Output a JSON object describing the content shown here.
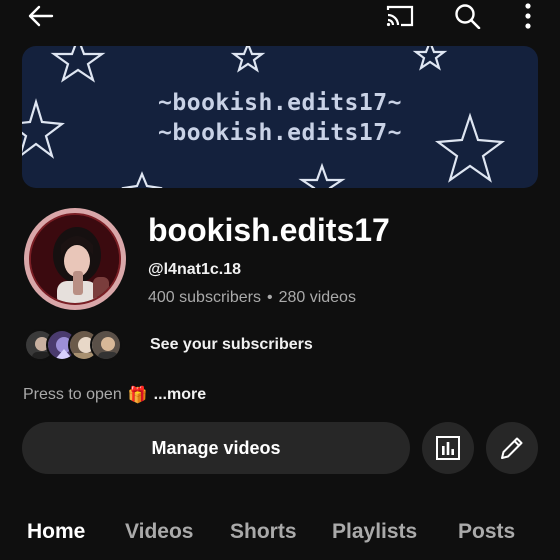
{
  "topbar": {
    "back_icon": "arrow-left-icon",
    "cast_icon": "cast-icon",
    "search_icon": "search-icon",
    "more_icon": "more-vert-icon"
  },
  "banner": {
    "line1": "~bookish.edits17~",
    "line2": "~bookish.edits17~",
    "background_color": "#14213d"
  },
  "channel": {
    "name": "bookish.edits17",
    "handle": "@l4nat1c.18",
    "subscribers": "400 subscribers",
    "separator": "•",
    "videos": "280 videos"
  },
  "subscribers_row": {
    "label": "See your subscribers"
  },
  "description": {
    "text": "Press to open",
    "emoji": "🎁",
    "more": "...more"
  },
  "actions": {
    "manage_label": "Manage videos",
    "analytics_icon": "analytics-icon",
    "edit_icon": "pencil-icon"
  },
  "tabs": [
    {
      "label": "Home",
      "active": true
    },
    {
      "label": "Videos",
      "active": false
    },
    {
      "label": "Shorts",
      "active": false
    },
    {
      "label": "Playlists",
      "active": false
    },
    {
      "label": "Posts",
      "active": false
    }
  ]
}
